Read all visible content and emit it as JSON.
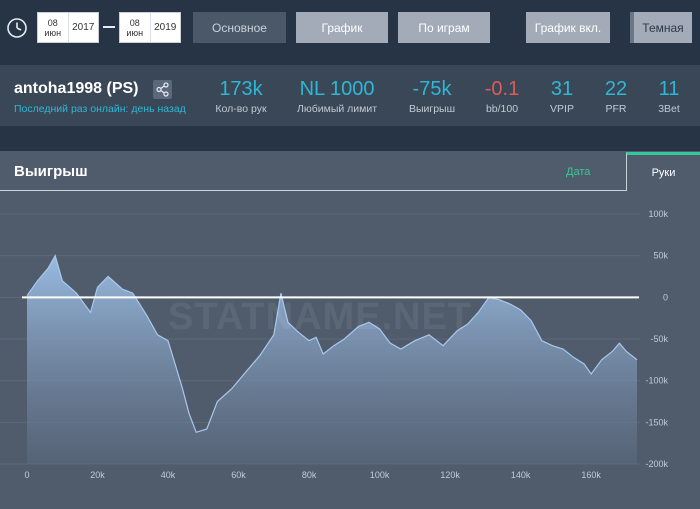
{
  "toolbar": {
    "date_from": {
      "day": "08",
      "month": "июн",
      "year": "2017"
    },
    "date_to": {
      "day": "08",
      "month": "июн",
      "year": "2019"
    },
    "buttons": {
      "main": "Основное",
      "graph": "График",
      "by_games": "По играм",
      "graph_on": "График вкл.",
      "theme": "Темная"
    }
  },
  "player": {
    "name": "antoha1998 (PS)",
    "last_online": "Последний раз онлайн: день назад"
  },
  "stats": [
    {
      "value": "173k",
      "label": "Кол-во рук"
    },
    {
      "value": "NL 1000",
      "label": "Любимый лимит"
    },
    {
      "value": "-75k",
      "label": "Выигрыш"
    },
    {
      "value": "-0.1",
      "label": "bb/100"
    },
    {
      "value": "31",
      "label": "VPIP"
    },
    {
      "value": "22",
      "label": "PFR"
    },
    {
      "value": "11",
      "label": "3Bet"
    }
  ],
  "panel": {
    "title": "Выигрыш",
    "tab_date": "Дата",
    "tab_hands": "Руки",
    "watermark": "STATNAME.NET"
  },
  "chart_data": {
    "type": "area",
    "x_ticks": [
      "0",
      "20k",
      "40k",
      "60k",
      "80k",
      "100k",
      "120k",
      "140k",
      "160k"
    ],
    "y_ticks": [
      "100k",
      "50k",
      "0",
      "-50k",
      "-100k",
      "-150k",
      "-200k"
    ],
    "xlim": [
      0,
      173000
    ],
    "ylim": [
      -200000,
      100000
    ],
    "zero_line": true,
    "grid": true,
    "x": [
      0,
      3000,
      6000,
      8000,
      10000,
      14000,
      18000,
      20000,
      23000,
      27000,
      30000,
      34000,
      37000,
      40000,
      42000,
      44000,
      46000,
      48000,
      51000,
      54000,
      58000,
      62000,
      66000,
      70000,
      72000,
      74000,
      77000,
      80000,
      82000,
      84000,
      87000,
      90000,
      94000,
      97000,
      100000,
      103000,
      106000,
      110000,
      114000,
      118000,
      122000,
      125000,
      128000,
      131000,
      134000,
      137000,
      140000,
      143000,
      146000,
      149000,
      152000,
      155000,
      158000,
      160000,
      163000,
      166000,
      168000,
      170000,
      173000
    ],
    "y": [
      2000,
      20000,
      35000,
      50000,
      20000,
      5000,
      -18000,
      12000,
      25000,
      10000,
      5000,
      -22000,
      -45000,
      -52000,
      -80000,
      -108000,
      -140000,
      -162000,
      -158000,
      -125000,
      -110000,
      -90000,
      -70000,
      -45000,
      5000,
      -30000,
      -42000,
      -52000,
      -48000,
      -68000,
      -58000,
      -50000,
      -35000,
      -30000,
      -38000,
      -55000,
      -62000,
      -52000,
      -45000,
      -58000,
      -40000,
      -32000,
      -18000,
      0,
      -3000,
      -8000,
      -15000,
      -28000,
      -52000,
      -58000,
      -62000,
      -72000,
      -80000,
      -92000,
      -75000,
      -65000,
      -55000,
      -65000,
      -75000
    ]
  }
}
